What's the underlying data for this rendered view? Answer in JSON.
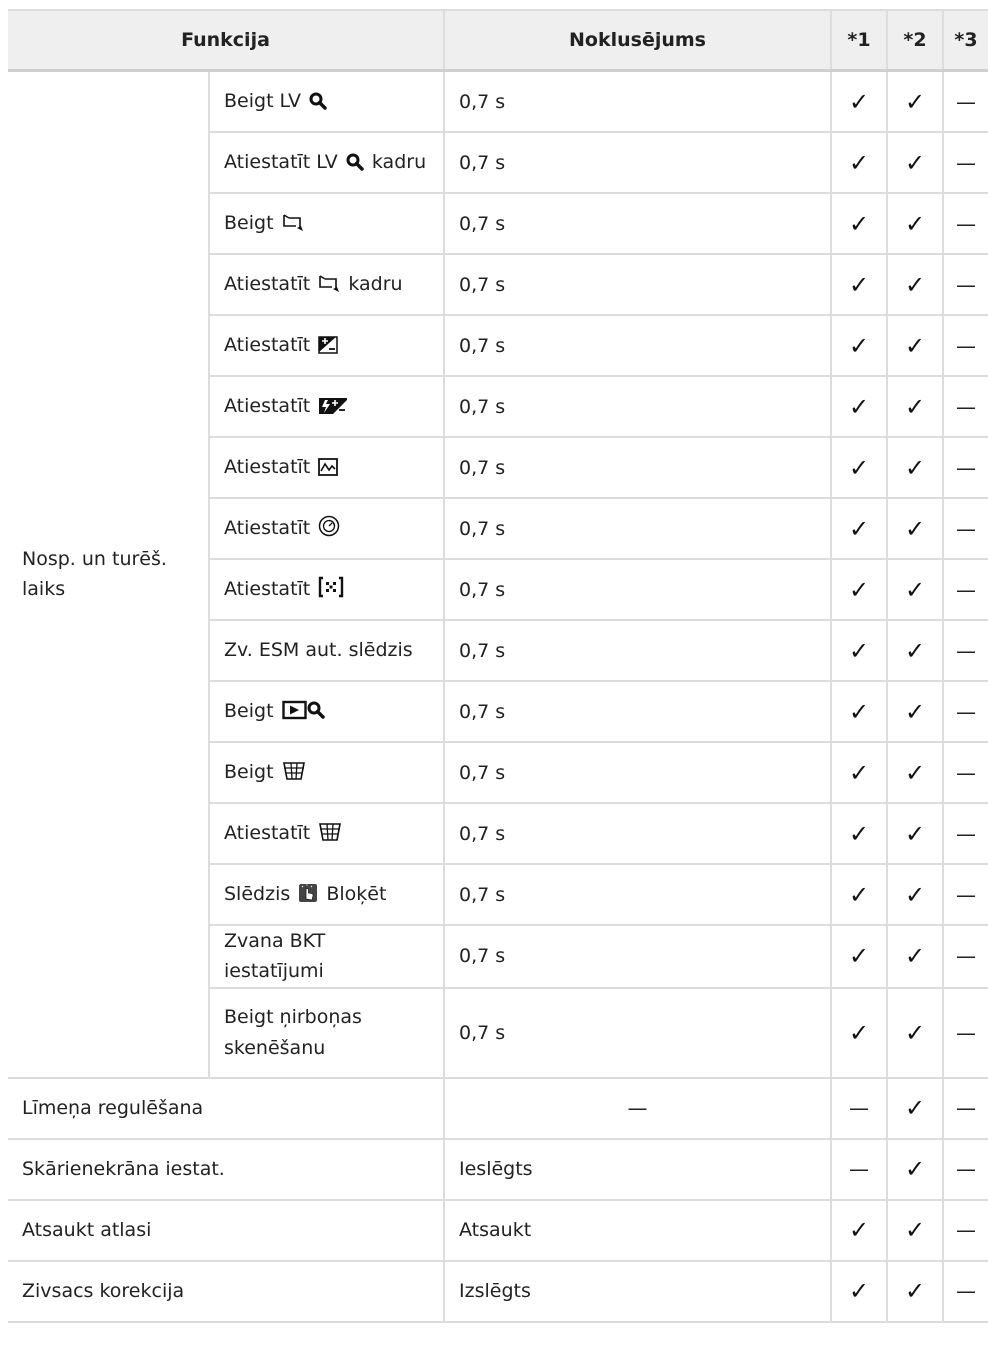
{
  "header": {
    "function": "Funkcija",
    "default": "Noklusējums",
    "col1": "*1",
    "col2": "*2",
    "col3": "*3"
  },
  "group": {
    "label": "Nosp. un turēš. laiks",
    "rows": [
      {
        "pre": "Beigt LV",
        "icon": "magnify-icon",
        "post": "",
        "value": "0,7 s",
        "c1": "✓",
        "c2": "✓",
        "c3": "—"
      },
      {
        "pre": "Atiestatīt LV",
        "icon": "magnify-icon",
        "post": "kadru",
        "value": "0,7 s",
        "c1": "✓",
        "c2": "✓",
        "c3": "—"
      },
      {
        "pre": "Beigt",
        "icon": "af-frame-icon",
        "post": "",
        "value": "0,7 s",
        "c1": "✓",
        "c2": "✓",
        "c3": "—"
      },
      {
        "pre": "Atiestatīt",
        "icon": "af-frame-icon",
        "post": "kadru",
        "value": "0,7 s",
        "c1": "✓",
        "c2": "✓",
        "c3": "—"
      },
      {
        "pre": "Atiestatīt",
        "icon": "exposure-comp-icon",
        "post": "",
        "value": "0,7 s",
        "c1": "✓",
        "c2": "✓",
        "c3": "—"
      },
      {
        "pre": "Atiestatīt",
        "icon": "flash-comp-icon",
        "post": "",
        "value": "0,7 s",
        "c1": "✓",
        "c2": "✓",
        "c3": "—"
      },
      {
        "pre": "Atiestatīt",
        "icon": "highlight-shadow-icon",
        "post": "",
        "value": "0,7 s",
        "c1": "✓",
        "c2": "✓",
        "c3": "—"
      },
      {
        "pre": "Atiestatīt",
        "icon": "timer-icon",
        "post": "",
        "value": "0,7 s",
        "c1": "✓",
        "c2": "✓",
        "c3": "—"
      },
      {
        "pre": "Atiestatīt",
        "icon": "af-target-icon",
        "post": "",
        "value": "0,7 s",
        "c1": "✓",
        "c2": "✓",
        "c3": "—"
      },
      {
        "pre": "Zv. ESM aut. slēdzis",
        "icon": "",
        "post": "",
        "value": "0,7 s",
        "c1": "✓",
        "c2": "✓",
        "c3": "—"
      },
      {
        "pre": "Beigt",
        "icon": "playback-magnify-icon",
        "post": "",
        "value": "0,7 s",
        "c1": "✓",
        "c2": "✓",
        "c3": "—"
      },
      {
        "pre": "Beigt",
        "icon": "keystone-icon",
        "post": "",
        "value": "0,7 s",
        "c1": "✓",
        "c2": "✓",
        "c3": "—"
      },
      {
        "pre": "Atiestatīt",
        "icon": "keystone-icon",
        "post": "",
        "value": "0,7 s",
        "c1": "✓",
        "c2": "✓",
        "c3": "—"
      },
      {
        "pre": "Slēdzis",
        "icon": "touch-icon",
        "post": "Bloķēt",
        "value": "0,7 s",
        "c1": "✓",
        "c2": "✓",
        "c3": "—"
      },
      {
        "pre": "Zvana BKT iestatījumi",
        "icon": "",
        "post": "",
        "value": "0,7 s",
        "c1": "✓",
        "c2": "✓",
        "c3": "—"
      },
      {
        "pre": "Beigt ņirboņas skenēšanu",
        "icon": "",
        "post": "",
        "value": "0,7 s",
        "c1": "✓",
        "c2": "✓",
        "c3": "—"
      }
    ]
  },
  "rows": [
    {
      "label": "Līmeņa regulēšana",
      "value": "—",
      "c1": "—",
      "c2": "✓",
      "c3": "—"
    },
    {
      "label": "Skārienekrāna iestat.",
      "value": "Ieslēgts",
      "c1": "—",
      "c2": "✓",
      "c3": "—"
    },
    {
      "label": "Atsaukt atlasi",
      "value": "Atsaukt",
      "c1": "✓",
      "c2": "✓",
      "c3": "—"
    },
    {
      "label": "Zivsacs korekcija",
      "value": "Izslēgts",
      "c1": "✓",
      "c2": "✓",
      "c3": "—"
    }
  ]
}
